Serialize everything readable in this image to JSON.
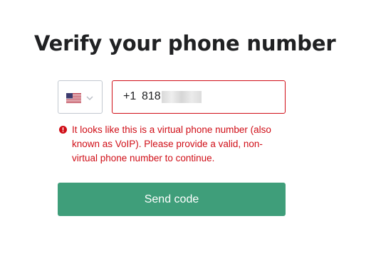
{
  "heading": {
    "title": "Verify your phone number"
  },
  "phone": {
    "country_icon": "us-flag-icon",
    "dial_code": "+1",
    "value": "818"
  },
  "error": {
    "icon": "exclamation-circle-icon",
    "message": "It looks like this is a virtual phone number (also known as VoIP). Please provide a valid, non-virtual phone number to continue."
  },
  "actions": {
    "send_label": "Send code"
  },
  "colors": {
    "error": "#d00e17",
    "button": "#3f9e7a",
    "input_border": "#c2c8d0"
  }
}
